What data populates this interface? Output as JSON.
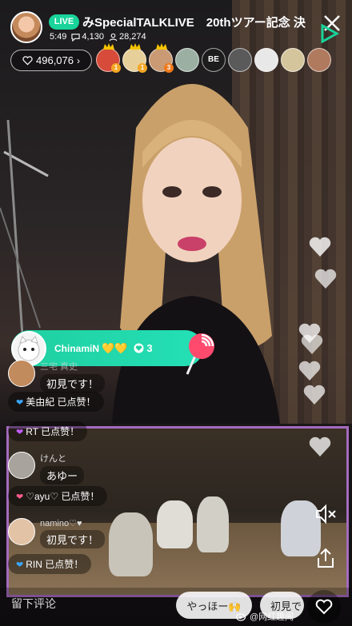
{
  "header": {
    "live_label": "LIVE",
    "title": "みSpecialTALKLIVE　20thツアー記念 決",
    "time": "5:49",
    "comments": "4,130",
    "viewers": "28,274",
    "likes": "496,076"
  },
  "top_viewers": [
    {
      "icon": "viewer-avatar",
      "badge": "1",
      "crown": true
    },
    {
      "icon": "viewer-avatar",
      "badge": "1",
      "crown": true
    },
    {
      "icon": "viewer-avatar",
      "badge": "3",
      "crown": true
    },
    {
      "icon": "viewer-avatar",
      "badge": "",
      "crown": false
    },
    {
      "icon": "viewer-avatar-be",
      "label": "BE",
      "badge": "",
      "crown": false
    },
    {
      "icon": "viewer-avatar",
      "badge": "",
      "crown": false
    },
    {
      "icon": "viewer-avatar",
      "badge": "",
      "crown": false
    },
    {
      "icon": "viewer-avatar",
      "badge": "",
      "crown": false
    },
    {
      "icon": "viewer-avatar",
      "badge": "",
      "crown": false
    }
  ],
  "gift": {
    "user": "ChinamiN",
    "hearts": "💛💛",
    "count": "3"
  },
  "chat": [
    {
      "type": "message",
      "user": "三宅 真史",
      "text": "初見です！"
    },
    {
      "type": "like",
      "text": "美由紀 已点赞！",
      "heart_color": "#3aa6ff"
    },
    {
      "type": "like",
      "text": "RT 已点赞！",
      "heart_color": "#c05cff"
    },
    {
      "type": "message",
      "user": "けんと",
      "text": "あゆー"
    },
    {
      "type": "like",
      "text": "♡ayu♡ 已点赞！",
      "heart_color": "#ff5c8a"
    },
    {
      "type": "message",
      "user": "namino♡♥",
      "text": "初見です！"
    },
    {
      "type": "like",
      "text": "RIN 已点赞！",
      "heart_color": "#3aa6ff"
    }
  ],
  "bottom": {
    "comment_placeholder": "留下评论",
    "quick_reply_1": "やっほー🙌",
    "quick_reply_2": "初見で"
  },
  "watermark": "@网红趣闻",
  "colors": {
    "accent": "#19d49a",
    "pip_border": "#a56bbf"
  }
}
